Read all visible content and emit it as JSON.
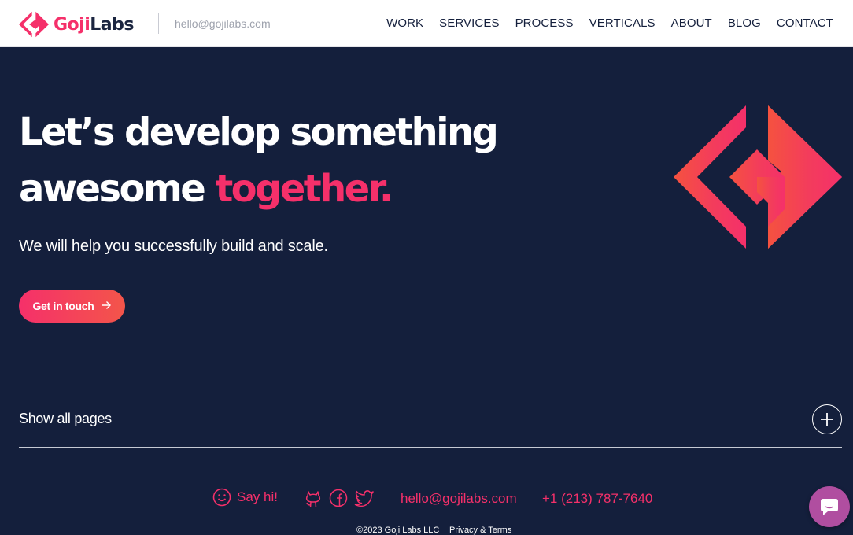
{
  "header": {
    "logo": {
      "goji": "Goji",
      "labs": "Labs"
    },
    "email": "hello@gojilabs.com",
    "nav": [
      "WORK",
      "SERVICES",
      "PROCESS",
      "VERTICALS",
      "ABOUT",
      "BLOG",
      "CONTACT"
    ]
  },
  "hero": {
    "title_line1": "Let’s develop something",
    "title_line2_plain": "awesome ",
    "title_line2_accent": "together.",
    "subtitle": "We will help you successfully build and scale.",
    "cta_label": "Get in touch",
    "cta_icon": "arrow-right-icon"
  },
  "pages_toggle": {
    "label": "Show all pages",
    "icon": "plus-icon"
  },
  "footer": {
    "say_hi": "Say hi!",
    "say_hi_icon": "smiley-icon",
    "social_icons": [
      "github-icon",
      "facebook-icon",
      "twitter-icon"
    ],
    "email": "hello@gojilabs.com",
    "phone": "+1 (213) 787-7640",
    "copyright": "©2023 Goji Labs LLC",
    "privacy": "Privacy & Terms"
  },
  "chat": {
    "icon": "chat-bubble-icon"
  },
  "colors": {
    "background": "#141f3c",
    "accent": "#f5306a",
    "accent_secondary": "#f3554a",
    "chat": "#b04ea0"
  }
}
